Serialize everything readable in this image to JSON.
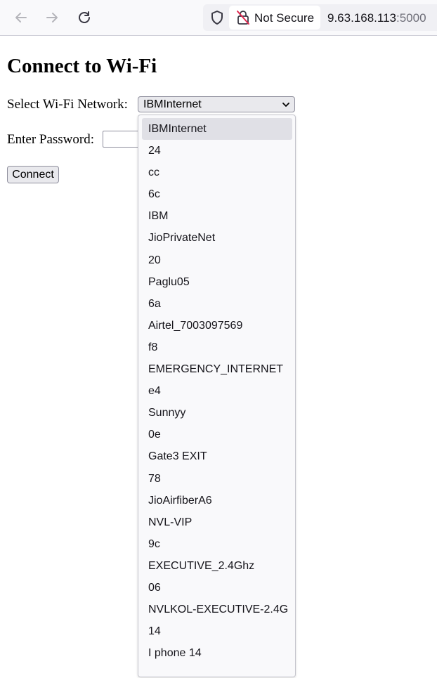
{
  "browser": {
    "security_label": "Not Secure",
    "url_host": "9.63.168.113",
    "url_port": ":5000",
    "icons": [
      "back-arrow-icon",
      "forward-arrow-icon",
      "reload-icon",
      "shield-icon",
      "insecure-lock-icon"
    ]
  },
  "page": {
    "title": "Connect to Wi-Fi",
    "network_label": "Select Wi-Fi Network:",
    "selected_network": "IBMInternet",
    "password_label": "Enter Password:",
    "password_value": "",
    "connect_label": "Connect"
  },
  "dropdown": {
    "options": [
      "IBMInternet",
      "24",
      "cc",
      "6c",
      "IBM",
      "JioPrivateNet",
      "20",
      "Paglu05",
      "6a",
      "Airtel_7003097569",
      "f8",
      "EMERGENCY_INTERNET",
      "e4",
      "Sunnyy",
      "0e",
      "Gate3 EXIT",
      "78",
      "JioAirfiberA6",
      "NVL-VIP",
      "9c",
      "EXECUTIVE_2.4Ghz",
      "06",
      "NVLKOL-EXECUTIVE-2.4G",
      "14",
      "I phone 14"
    ]
  }
}
